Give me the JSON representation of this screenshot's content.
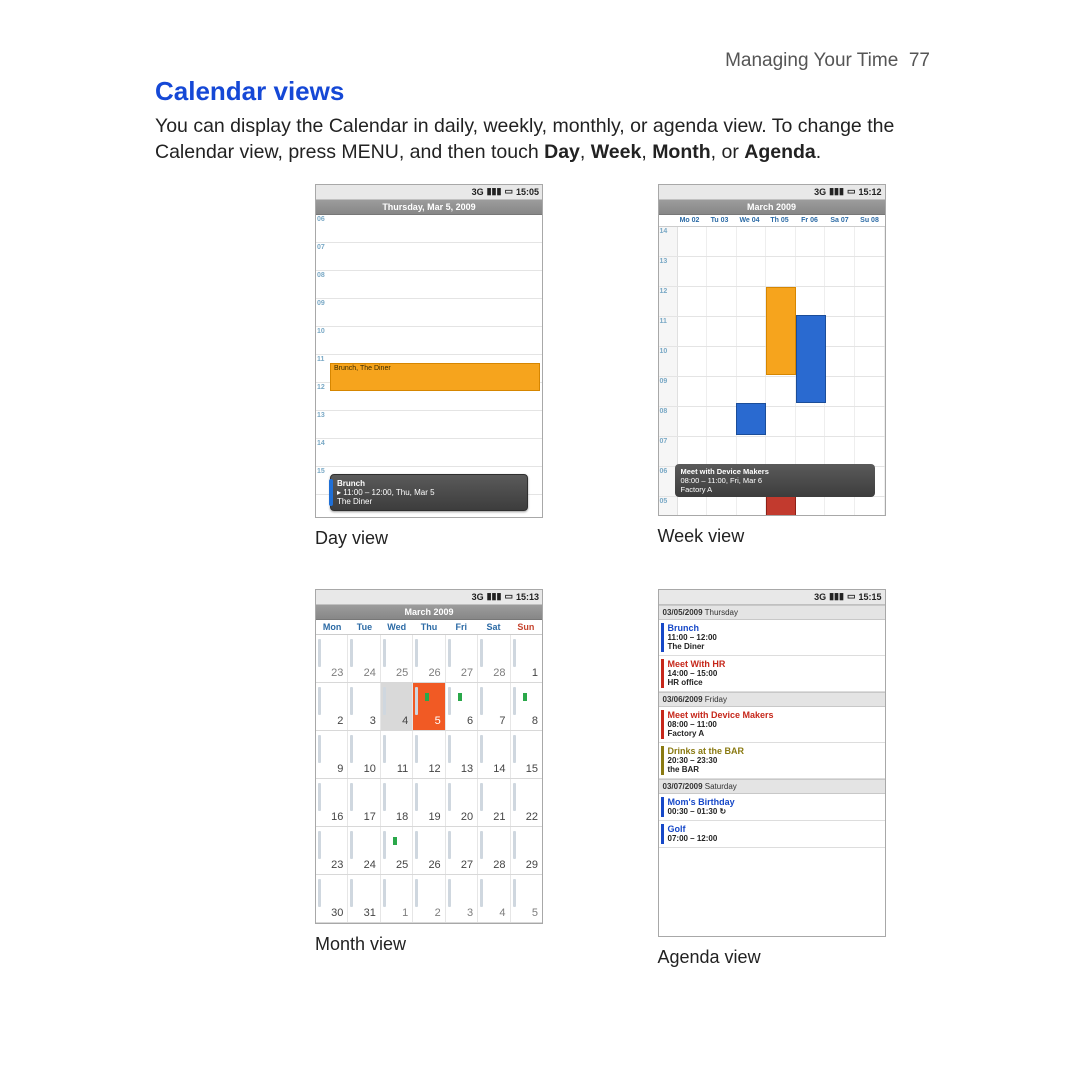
{
  "header": {
    "chapter": "Managing Your Time",
    "page": "77"
  },
  "section_title": "Calendar views",
  "intro_parts": {
    "a": "You can display the Calendar in daily, weekly, monthly, or agenda view. To change the Calendar view, press MENU, and then touch ",
    "b": "Day",
    "c": ", ",
    "d": "Week",
    "e": ", ",
    "f": "Month",
    "g": ", or ",
    "h": "Agenda",
    "i": "."
  },
  "captions": {
    "day": "Day view",
    "week": "Week view",
    "month": "Month view",
    "agenda": "Agenda view"
  },
  "status_times": {
    "day": "15:05",
    "week": "15:12",
    "month": "15:13",
    "agenda": "15:15"
  },
  "status_icons": {
    "net": "3G",
    "sig": "▮▮▮",
    "bat": "▭"
  },
  "day": {
    "title": "Thursday, Mar 5, 2009",
    "hours": [
      "06",
      "07",
      "08",
      "09",
      "10",
      "11",
      "12",
      "13",
      "14",
      "15"
    ],
    "event_label": "Brunch, The Diner",
    "popup": {
      "title": "Brunch",
      "time": "▸ 11:00 – 12:00, Thu, Mar 5",
      "loc": "The Diner"
    }
  },
  "week": {
    "title": "March 2009",
    "days": [
      "Mo 02",
      "Tu 03",
      "We 04",
      "Th 05",
      "Fr 06",
      "Sa 07",
      "Su 08"
    ],
    "hours": [
      "05",
      "06",
      "07",
      "08",
      "09",
      "10",
      "11",
      "12",
      "13",
      "14"
    ],
    "popup": {
      "title": "Meet with Device Makers",
      "time": "08:00 – 11:00, Fri, Mar 6",
      "loc": "Factory A"
    }
  },
  "month": {
    "title": "March 2009",
    "dow": [
      "Mon",
      "Tue",
      "Wed",
      "Thu",
      "Fri",
      "Sat",
      "Sun"
    ],
    "rows": [
      [
        {
          "n": "23"
        },
        {
          "n": "24"
        },
        {
          "n": "25"
        },
        {
          "n": "26"
        },
        {
          "n": "27"
        },
        {
          "n": "28"
        },
        {
          "n": "1",
          "in": true
        }
      ],
      [
        {
          "n": "2",
          "in": true
        },
        {
          "n": "3",
          "in": true
        },
        {
          "n": "4",
          "in": true,
          "shade": true
        },
        {
          "n": "5",
          "in": true,
          "today": true,
          "dot": true
        },
        {
          "n": "6",
          "in": true,
          "dot": true
        },
        {
          "n": "7",
          "in": true
        },
        {
          "n": "8",
          "in": true,
          "dot": true
        }
      ],
      [
        {
          "n": "9",
          "in": true
        },
        {
          "n": "10",
          "in": true
        },
        {
          "n": "11",
          "in": true
        },
        {
          "n": "12",
          "in": true
        },
        {
          "n": "13",
          "in": true
        },
        {
          "n": "14",
          "in": true
        },
        {
          "n": "15",
          "in": true
        }
      ],
      [
        {
          "n": "16",
          "in": true
        },
        {
          "n": "17",
          "in": true
        },
        {
          "n": "18",
          "in": true
        },
        {
          "n": "19",
          "in": true
        },
        {
          "n": "20",
          "in": true
        },
        {
          "n": "21",
          "in": true
        },
        {
          "n": "22",
          "in": true
        }
      ],
      [
        {
          "n": "23",
          "in": true
        },
        {
          "n": "24",
          "in": true
        },
        {
          "n": "25",
          "in": true,
          "dot": true
        },
        {
          "n": "26",
          "in": true
        },
        {
          "n": "27",
          "in": true
        },
        {
          "n": "28",
          "in": true
        },
        {
          "n": "29",
          "in": true
        }
      ],
      [
        {
          "n": "30",
          "in": true
        },
        {
          "n": "31",
          "in": true
        },
        {
          "n": "1"
        },
        {
          "n": "2"
        },
        {
          "n": "3"
        },
        {
          "n": "4"
        },
        {
          "n": "5"
        }
      ]
    ]
  },
  "agenda": {
    "groups": [
      {
        "date": "03/05/2009",
        "dow": "Thursday",
        "items": [
          {
            "title": "Brunch",
            "color": "blue",
            "time": "11:00 – 12:00",
            "loc": "The Diner"
          },
          {
            "title": "Meet With HR",
            "color": "red",
            "time": "14:00 – 15:00",
            "loc": "HR office"
          }
        ]
      },
      {
        "date": "03/06/2009",
        "dow": "Friday",
        "items": [
          {
            "title": "Meet with Device Makers",
            "color": "red",
            "time": "08:00 – 11:00",
            "loc": "Factory A"
          },
          {
            "title": "Drinks at the BAR",
            "color": "olive",
            "time": "20:30 – 23:30",
            "loc": "the BAR"
          }
        ]
      },
      {
        "date": "03/07/2009",
        "dow": "Saturday",
        "items": [
          {
            "title": "Mom's Birthday",
            "color": "blue",
            "time": "00:30 – 01:30",
            "loc": "",
            "recur": true
          },
          {
            "title": "Golf",
            "color": "blue",
            "time": "07:00 – 12:00",
            "loc": ""
          }
        ]
      }
    ]
  }
}
